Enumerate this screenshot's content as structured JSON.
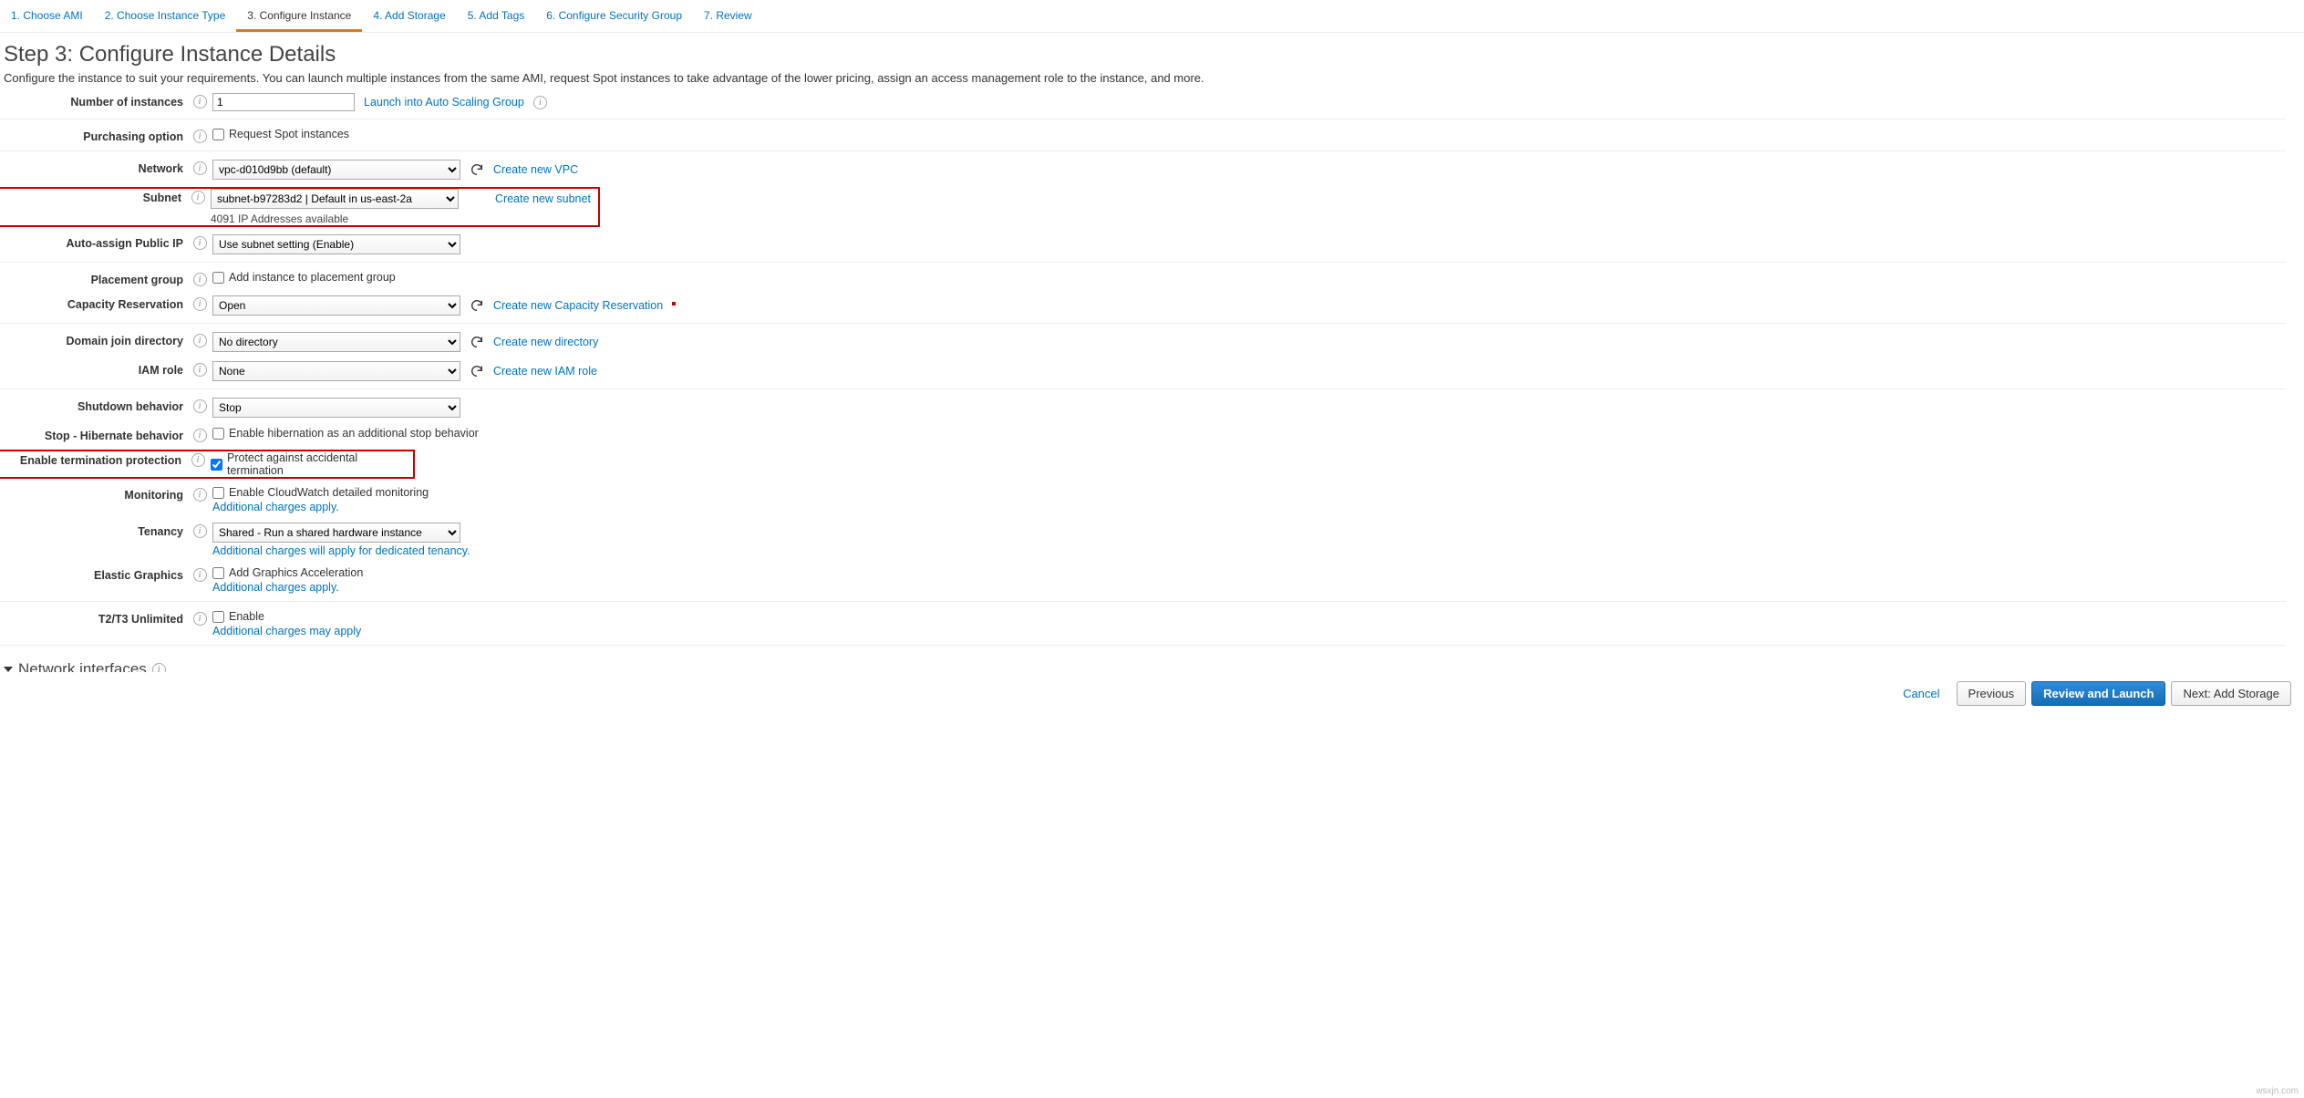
{
  "wizard": {
    "steps": [
      "1. Choose AMI",
      "2. Choose Instance Type",
      "3. Configure Instance",
      "4. Add Storage",
      "5. Add Tags",
      "6. Configure Security Group",
      "7. Review"
    ],
    "active_index": 2
  },
  "page": {
    "title": "Step 3: Configure Instance Details",
    "description": "Configure the instance to suit your requirements. You can launch multiple instances from the same AMI, request Spot instances to take advantage of the lower pricing, assign an access management role to the instance, and more."
  },
  "fields": {
    "number_of_instances": {
      "label": "Number of instances",
      "value": "1",
      "link": "Launch into Auto Scaling Group"
    },
    "purchasing_option": {
      "label": "Purchasing option",
      "checkbox_label": "Request Spot instances",
      "checked": false
    },
    "network": {
      "label": "Network",
      "value": "vpc-d010d9bb (default)",
      "link": "Create new VPC"
    },
    "subnet": {
      "label": "Subnet",
      "value": "subnet-b97283d2 | Default in us-east-2a",
      "note": "4091 IP Addresses available",
      "link": "Create new subnet"
    },
    "auto_assign_public_ip": {
      "label": "Auto-assign Public IP",
      "value": "Use subnet setting (Enable)"
    },
    "placement_group": {
      "label": "Placement group",
      "checkbox_label": "Add instance to placement group",
      "checked": false
    },
    "capacity_reservation": {
      "label": "Capacity Reservation",
      "value": "Open",
      "link": "Create new Capacity Reservation"
    },
    "domain_join_directory": {
      "label": "Domain join directory",
      "value": "No directory",
      "link": "Create new directory"
    },
    "iam_role": {
      "label": "IAM role",
      "value": "None",
      "link": "Create new IAM role"
    },
    "shutdown_behavior": {
      "label": "Shutdown behavior",
      "value": "Stop"
    },
    "stop_hibernate": {
      "label": "Stop - Hibernate behavior",
      "checkbox_label": "Enable hibernation as an additional stop behavior",
      "checked": false
    },
    "termination_protection": {
      "label": "Enable termination protection",
      "checkbox_label": "Protect against accidental termination",
      "checked": true
    },
    "monitoring": {
      "label": "Monitoring",
      "checkbox_label": "Enable CloudWatch detailed monitoring",
      "checked": false,
      "note_link": "Additional charges apply."
    },
    "tenancy": {
      "label": "Tenancy",
      "value": "Shared - Run a shared hardware instance",
      "note_link": "Additional charges will apply for dedicated tenancy."
    },
    "elastic_graphics": {
      "label": "Elastic Graphics",
      "checkbox_label": "Add Graphics Acceleration",
      "checked": false,
      "note_link": "Additional charges apply."
    },
    "t2_t3_unlimited": {
      "label": "T2/T3 Unlimited",
      "checkbox_label": "Enable",
      "checked": false,
      "note_link": "Additional charges may apply"
    }
  },
  "sections": {
    "network_interfaces": "Network interfaces"
  },
  "footer": {
    "cancel": "Cancel",
    "previous": "Previous",
    "review_launch": "Review and Launch",
    "next": "Next: Add Storage"
  },
  "watermark": "wsxjn.com"
}
